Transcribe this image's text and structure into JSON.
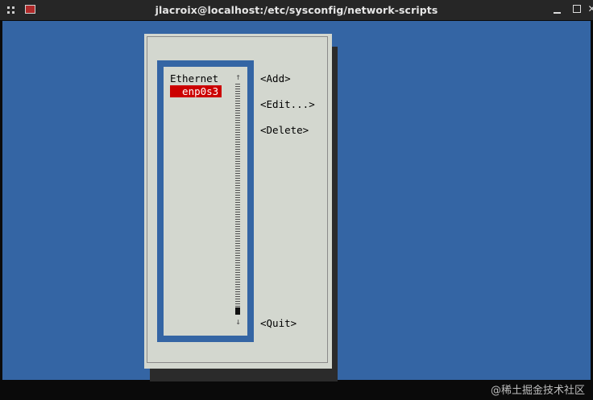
{
  "window": {
    "title": "jlacroix@localhost:/etc/sysconfig/network-scripts",
    "close_glyph": "✕"
  },
  "listbox": {
    "header": "Ethernet",
    "items": [
      {
        "label": "  enp0s3",
        "selected": true
      }
    ],
    "scroll_up_glyph": "↑",
    "scroll_down_glyph": "↓"
  },
  "buttons": {
    "add": "<Add>",
    "edit": "<Edit...>",
    "delete": "<Delete>",
    "quit": "<Quit>"
  },
  "watermark": "@稀土掘金技术社区",
  "colors": {
    "terminal_bg": "#3465a4",
    "dialog_bg": "#d3d7cf",
    "selection": "#cc0000"
  }
}
